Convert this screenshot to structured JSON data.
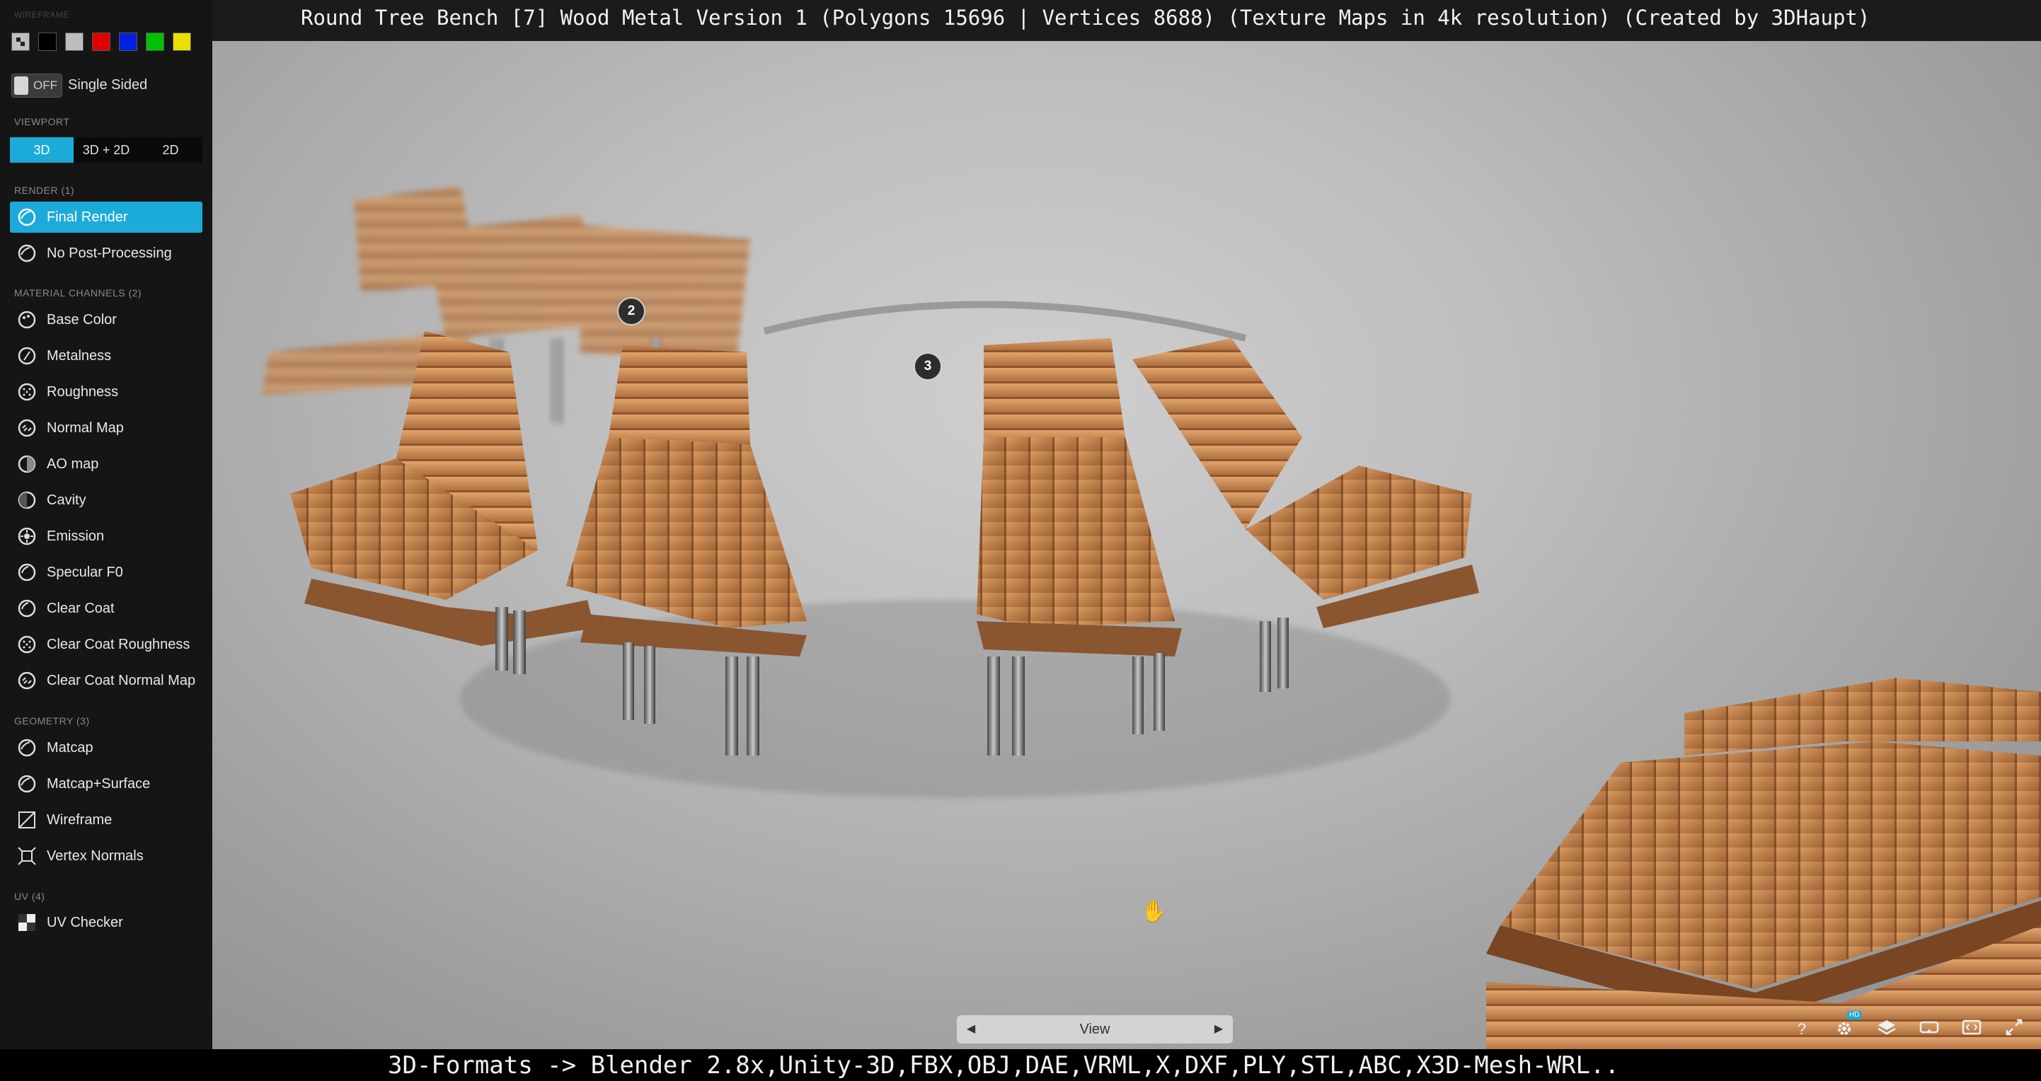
{
  "header": {
    "title": "Round Tree Bench [7] Wood Metal Version 1 (Polygons 15696 | Vertices 8688) (Texture Maps in 4k resolution) (Created by 3DHaupt)"
  },
  "sidebar": {
    "wireframe_label": "WIREFRAME",
    "wireframe_swatches": [
      "#bfbfbf",
      "#000000",
      "#bdbdbd",
      "#e00000",
      "#0020e0",
      "#00c000",
      "#e8e000"
    ],
    "single_sided": {
      "state": "OFF",
      "label": "Single Sided"
    },
    "viewport_label": "VIEWPORT",
    "viewport_modes": [
      "3D",
      "3D + 2D",
      "2D"
    ],
    "render_label": "RENDER (1)",
    "render_items": [
      {
        "label": "Final Render",
        "icon": "matcap-sphere-icon"
      },
      {
        "label": "No Post-Processing",
        "icon": "matcap-sphere-icon"
      }
    ],
    "material_label": "MATERIAL CHANNELS (2)",
    "material_items": [
      {
        "label": "Base Color",
        "icon": "palette-icon"
      },
      {
        "label": "Metalness",
        "icon": "metalness-icon"
      },
      {
        "label": "Roughness",
        "icon": "roughness-icon"
      },
      {
        "label": "Normal Map",
        "icon": "normal-map-icon"
      },
      {
        "label": "AO map",
        "icon": "ao-map-icon"
      },
      {
        "label": "Cavity",
        "icon": "cavity-icon"
      },
      {
        "label": "Emission",
        "icon": "emission-icon"
      },
      {
        "label": "Specular F0",
        "icon": "specular-icon"
      },
      {
        "label": "Clear Coat",
        "icon": "clear-coat-icon"
      },
      {
        "label": "Clear Coat Roughness",
        "icon": "clear-coat-roughness-icon"
      },
      {
        "label": "Clear Coat Normal Map",
        "icon": "clear-coat-normal-icon"
      }
    ],
    "geometry_label": "GEOMETRY (3)",
    "geometry_items": [
      {
        "label": "Matcap",
        "icon": "matcap-icon"
      },
      {
        "label": "Matcap+Surface",
        "icon": "matcap-surface-icon"
      },
      {
        "label": "Wireframe",
        "icon": "wireframe-icon"
      },
      {
        "label": "Vertex Normals",
        "icon": "vertex-normals-icon"
      }
    ],
    "uv_label": "UV (4)",
    "uv_items": [
      {
        "label": "UV Checker",
        "icon": "checker-icon"
      }
    ]
  },
  "viewport": {
    "annotations": [
      "2",
      "3"
    ],
    "nav_label": "View",
    "bench_color": "#c98a52"
  },
  "toolbar": {
    "icons": [
      "help-icon",
      "settings-hd-icon",
      "layers-icon",
      "vr-icon",
      "embed-icon",
      "fullscreen-icon"
    ],
    "help_glyph": "?",
    "hd_badge": "HD"
  },
  "footer": {
    "text": "3D-Formats -> Blender 2.8x,Unity-3D,FBX,OBJ,DAE,VRML,X,DXF,PLY,STL,ABC,X3D-Mesh-WRL.."
  }
}
